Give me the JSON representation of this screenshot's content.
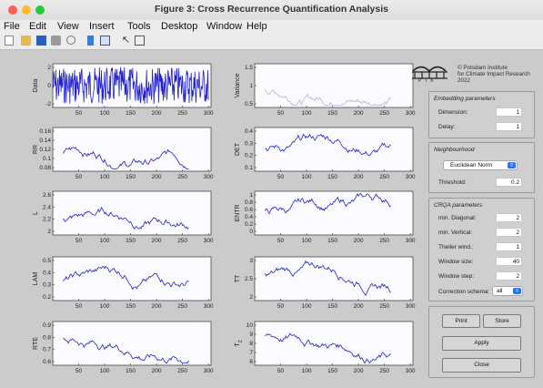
{
  "window": {
    "title": "Figure 3: Cross Recurrence Quantification Analysis",
    "traffic_lights": [
      "#fe5f57",
      "#febc2e",
      "#28c840"
    ]
  },
  "menubar": [
    "File",
    "Edit",
    "View",
    "Insert",
    "Tools",
    "Desktop",
    "Window",
    "Help"
  ],
  "toolbar_icons": [
    "new-figure-icon",
    "open-file-icon",
    "save-icon",
    "print-icon",
    "print-preview-icon",
    "link-plot-icon",
    "insert-colorbar-icon",
    "edit-plot-pointer-icon",
    "property-inspector-icon"
  ],
  "plots": {
    "x_ticks": [
      "50",
      "100",
      "150",
      "200",
      "250",
      "300"
    ],
    "data": {
      "ylabel": "Data",
      "yticks": [
        "2",
        "0",
        "-2"
      ]
    },
    "variance": {
      "ylabel": "Variance",
      "yticks": [
        "1.5",
        "1",
        "0.5"
      ]
    },
    "rr": {
      "ylabel": "RR",
      "yticks": [
        "0.16",
        "0.14",
        "0.12",
        "0.1",
        "0.08"
      ]
    },
    "det": {
      "ylabel": "DET",
      "yticks": [
        "0.4",
        "0.3",
        "0.2",
        "0.1"
      ]
    },
    "l": {
      "ylabel": "L",
      "yticks": [
        "2.6",
        "2.4",
        "2.2",
        "2"
      ]
    },
    "entr": {
      "ylabel": "ENTR",
      "yticks": [
        "1",
        "0.8",
        "0.6",
        "0.4",
        "0.2",
        "0"
      ]
    },
    "lam": {
      "ylabel": "LAM",
      "yticks": [
        "0.5",
        "0.4",
        "0.3",
        "0.2"
      ]
    },
    "tt": {
      "ylabel": "TT",
      "yticks": [
        "3",
        "2.5",
        "2"
      ]
    },
    "rte": {
      "ylabel": "RTE",
      "yticks": [
        "0.9",
        "0.8",
        "0.7",
        "0.6"
      ]
    },
    "t2": {
      "ylabel": "T",
      "ylabel_sub": "2",
      "yticks": [
        "10",
        "9",
        "8",
        "7",
        "6"
      ]
    }
  },
  "copyright": {
    "line1": "© Potsdam Institute",
    "line2": "for Climate Impact Research",
    "line3": "2022",
    "logo_text": "P I K"
  },
  "embedding": {
    "title": "Embedding parameters",
    "dimension_label": "Dimension:",
    "dimension_value": "1",
    "delay_label": "Delay:",
    "delay_value": "1"
  },
  "neighbourhood": {
    "title": "Neighbourhood",
    "norm_value": "Euclidean Norm",
    "threshold_label": "Threshold:",
    "threshold_value": "0.2"
  },
  "crqa": {
    "title": "CRQA parameters",
    "min_diag_label": "min. Diagonal:",
    "min_diag_value": "2",
    "min_vert_label": "min. Vertical:",
    "min_vert_value": "2",
    "theiler_label": "Theiler wind.:",
    "theiler_value": "1",
    "window_size_label": "Window size:",
    "window_size_value": "40",
    "window_step_label": "Window step:",
    "window_step_value": "2",
    "correction_label": "Correction schema:",
    "correction_value": "all"
  },
  "buttons": {
    "print": "Print",
    "store": "Store",
    "apply": "Apply",
    "close": "Close"
  }
}
